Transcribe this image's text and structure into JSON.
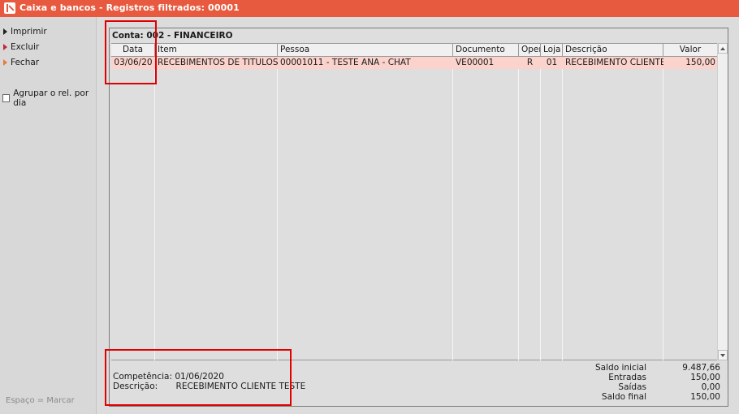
{
  "window": {
    "title": "Caixa e bancos - Registros filtrados: 00001"
  },
  "sidebar": {
    "items": [
      {
        "label": "Imprimir",
        "accent": "#222222"
      },
      {
        "label": "Excluir",
        "accent": "#c0283d"
      },
      {
        "label": "Fechar",
        "accent": "#e87a3a"
      }
    ],
    "group_checkbox": {
      "label": "Agrupar o rel. por dia",
      "checked": false
    },
    "hint": "Espaço = Marcar"
  },
  "account": {
    "label": "Conta: 002 - FINANCEIRO"
  },
  "table": {
    "columns": [
      "Data",
      "Item",
      "Pessoa",
      "Documento",
      "Oper",
      "Loja",
      "Descrição",
      "Valor"
    ],
    "rows": [
      [
        "03/06/20",
        "RECEBIMENTOS DE TITULOS",
        "00001011 - TESTE  ANA - CHAT",
        "VE00001",
        "R",
        "01",
        "RECEBIMENTO CLIENTE TESTE",
        "150,00"
      ]
    ],
    "selected_row_color": "#fbd3cc"
  },
  "detail": {
    "competencia_label": "Competência:",
    "competencia_value": "01/06/2020",
    "descricao_label": "Descrição:",
    "descricao_value": "RECEBIMENTO CLIENTE TESTE"
  },
  "totals": [
    {
      "label": "Saldo inicial",
      "value": "9.487,66"
    },
    {
      "label": "Entradas",
      "value": "150,00"
    },
    {
      "label": "Saídas",
      "value": "0,00"
    },
    {
      "label": "Saldo final",
      "value": "150,00"
    }
  ],
  "colors": {
    "title_bar": "#e85a3f",
    "highlight": "#e00000"
  }
}
